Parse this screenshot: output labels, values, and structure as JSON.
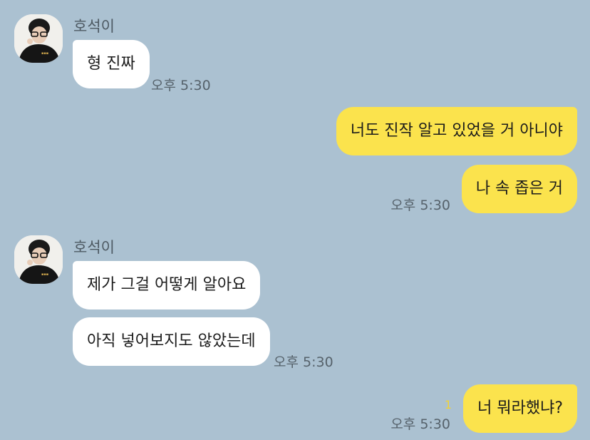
{
  "colors": {
    "background": "#abc1d1",
    "incoming_bubble": "#ffffff",
    "outgoing_bubble": "#fbe34d",
    "unread_count": "#f0d23a"
  },
  "messages": {
    "group1": {
      "sender": "호석이",
      "text1": "형 진짜",
      "time": "오후 5:30"
    },
    "group2": {
      "text1": "너도 진작 알고 있었을 거 아니야",
      "text2": "나 속 좁은 거",
      "time": "오후 5:30"
    },
    "group3": {
      "sender": "호석이",
      "text1": "제가 그걸 어떻게 알아요",
      "text2": "아직 넣어보지도 않았는데",
      "time": "오후 5:30"
    },
    "group4": {
      "unread": "1",
      "text1": "너 뭐라했냐?",
      "time": "오후 5:30"
    }
  }
}
